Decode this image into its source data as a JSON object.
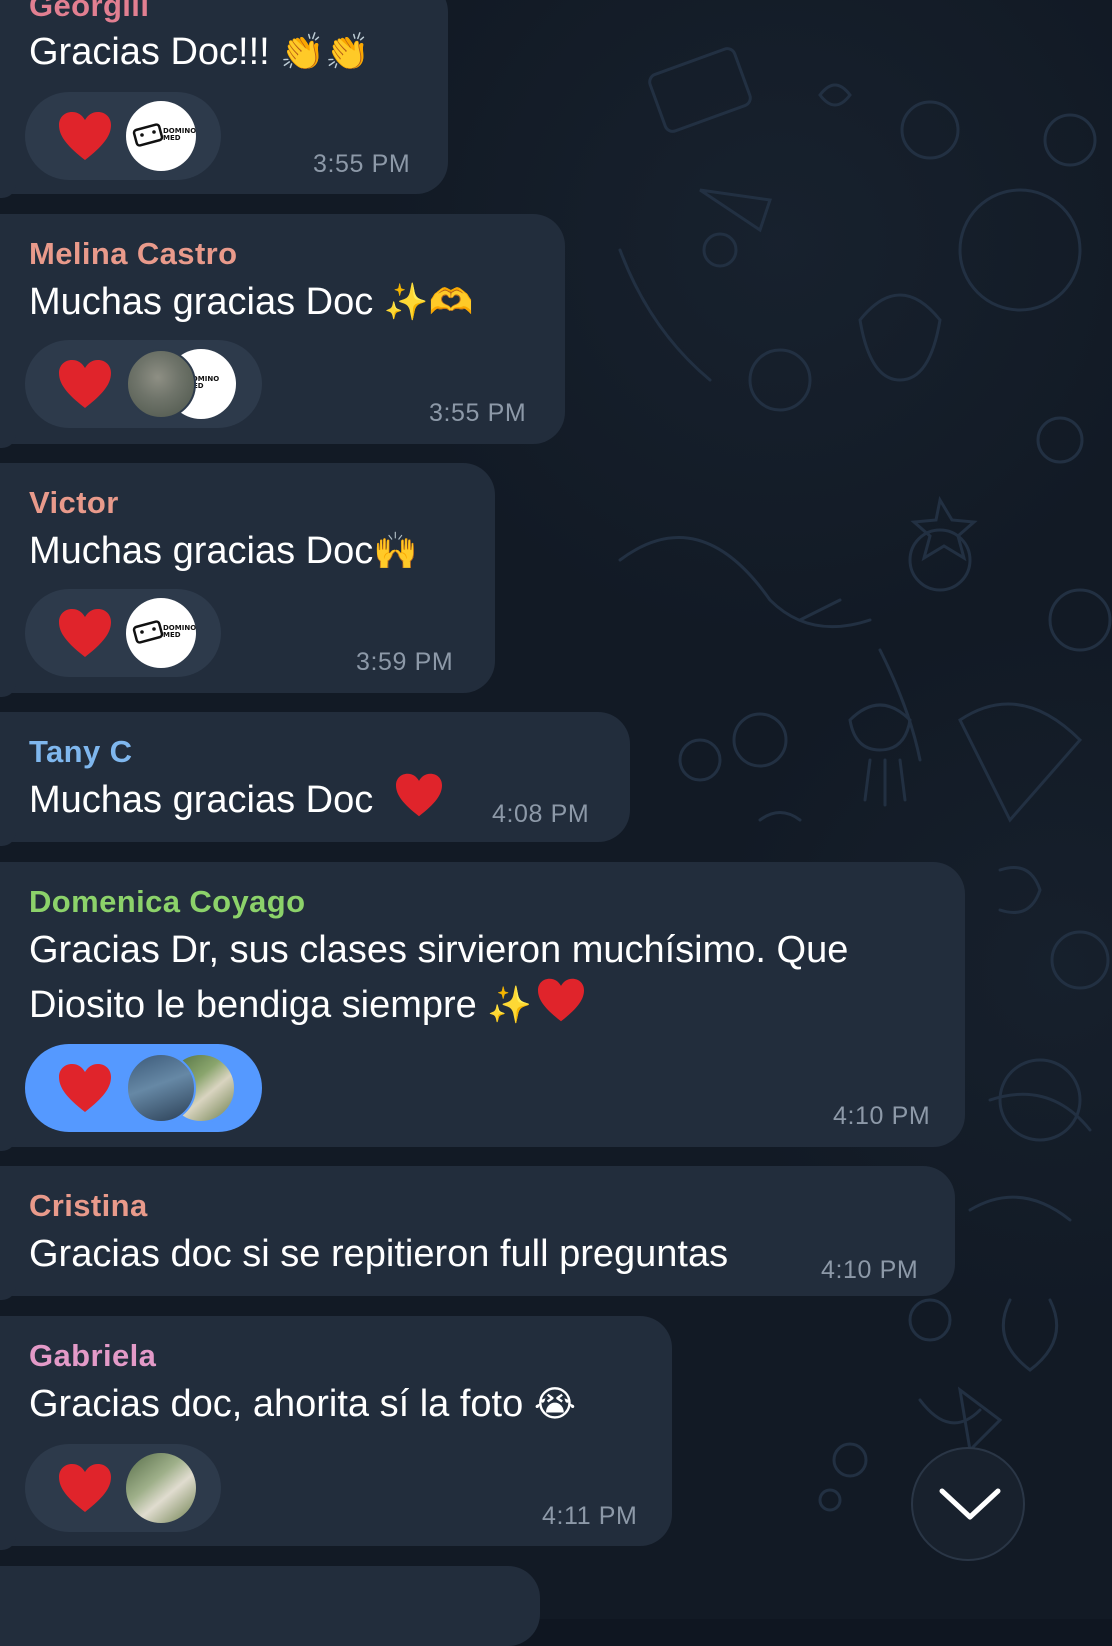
{
  "colors": {
    "bubble": "#222d3c",
    "reaction_bg": "#2d3a4b",
    "reaction_selected": "#5599ff",
    "time": "#8d99a8",
    "background": "#121a25"
  },
  "messages": [
    {
      "sender": "Georgiii",
      "sender_color": "#e27f91",
      "text": "Gracias Doc!!!",
      "emoji": "👏👏",
      "time": "3:55 PM",
      "reaction": {
        "emoji": "heart",
        "selected": false,
        "avatars": [
          "domino-med-logo"
        ]
      }
    },
    {
      "sender": "Melina Castro",
      "sender_color": "#e99a8b",
      "text": "Muchas gracias Doc",
      "emoji": "✨🫶",
      "time": "3:55 PM",
      "reaction": {
        "emoji": "heart",
        "selected": false,
        "avatars": [
          "user-photo",
          "domino-med-logo"
        ]
      }
    },
    {
      "sender": "Victor",
      "sender_color": "#e99a8b",
      "text": "Muchas gracias Doc",
      "emoji": "🙌",
      "time": "3:59 PM",
      "reaction": {
        "emoji": "heart",
        "selected": false,
        "avatars": [
          "domino-med-logo"
        ]
      }
    },
    {
      "sender": "Tany C",
      "sender_color": "#7fb7ee",
      "text": "Muchas gracias Doc",
      "emoji": "❤",
      "time": "4:08 PM"
    },
    {
      "sender": "Domenica Coyago",
      "sender_color": "#8cd26a",
      "text_line1": "Gracias Dr, sus clases sirvieron muchísimo. Que",
      "text_line2": "Diosito le bendiga siempre",
      "emoji": "✨❤",
      "time": "4:10 PM",
      "reaction": {
        "emoji": "heart",
        "selected": true,
        "avatars": [
          "user-photo",
          "user-photo"
        ]
      }
    },
    {
      "sender": "Cristina",
      "sender_color": "#e99a8b",
      "text": "Gracias doc si se repitieron full preguntas",
      "time": "4:10 PM"
    },
    {
      "sender": "Gabriela",
      "sender_color": "#e39ac8",
      "text": "Gracias doc, ahorita sí la foto",
      "emoji": "😭",
      "time": "4:11 PM",
      "reaction": {
        "emoji": "heart",
        "selected": false,
        "avatars": [
          "user-photo"
        ]
      }
    }
  ],
  "logo": {
    "line1": "DOMINO",
    "line2": "MED"
  },
  "scroll_button": {
    "icon": "chevron-down-icon"
  }
}
